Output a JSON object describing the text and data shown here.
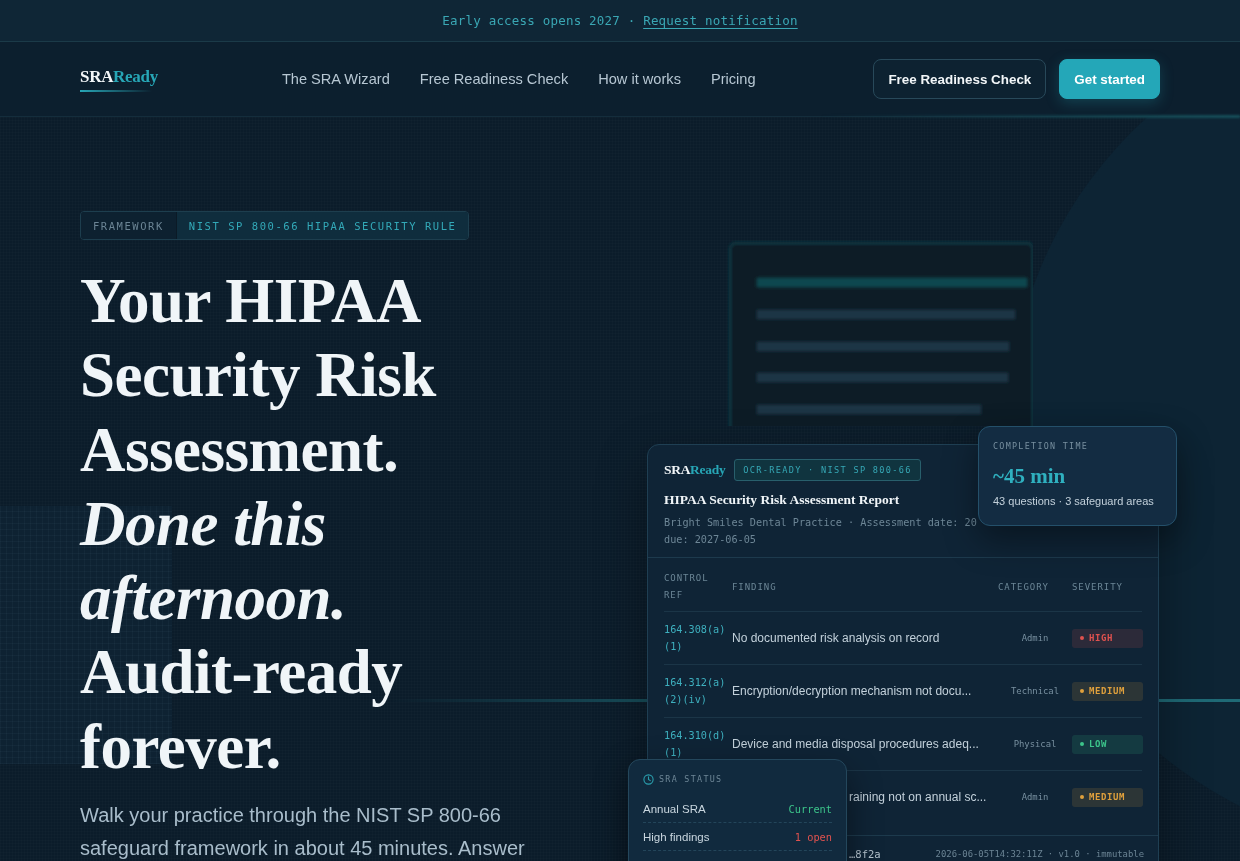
{
  "announcement": {
    "text": "Early access opens 2027 ·",
    "link": "Request notification"
  },
  "nav": {
    "logo": {
      "lead": "SRA",
      "accent": "Ready"
    },
    "links": [
      "The SRA Wizard",
      "Free Readiness Check",
      "How it works",
      "Pricing"
    ],
    "buttons": [
      {
        "label": "Free Readiness Check",
        "kind": "outline"
      },
      {
        "label": "Get started",
        "kind": "primary"
      }
    ]
  },
  "hero": {
    "tag": {
      "label": "FRAMEWORK",
      "value": "NIST SP 800-66 HIPAA SECURITY RULE"
    },
    "heading": "Your HIPAA Security Risk Assessment. *Done this afternoon.* Audit-ready forever.",
    "intro": "Walk your practice through the NIST SP 800-66 safeguard framework in about 45 minutes. Answer"
  },
  "report": {
    "logo": {
      "lead": "SRA",
      "accent": "Ready"
    },
    "badge": "OCR-READY · NIST SP 800-66",
    "title": "HIPAA Security Risk Assessment Report",
    "meta": [
      "Bright Smiles Dental Practice · Assessment date: 20",
      "due: 2027-06-05"
    ],
    "columns": [
      "CONTROL REF",
      "FINDING",
      "CATEGORY",
      "SEVERITY"
    ],
    "rows": [
      {
        "ref": "164.308(a)(1)",
        "finding": "No documented risk analysis on record",
        "category": "Admin",
        "severity": "HIGH",
        "color": "#e0524f"
      },
      {
        "ref": "164.312(a)(2)(iv)",
        "finding": "Encryption/decryption mechanism not docu...",
        "category": "Technical",
        "severity": "MEDIUM",
        "color": "#e0a03c"
      },
      {
        "ref": "164.310(d)(1)",
        "finding": "Device and media disposal procedures adeq...",
        "category": "Physical",
        "severity": "LOW",
        "color": "#3cc48a"
      },
      {
        "finding": "raining not on annual sc...",
        "category": "Admin",
        "severity": "MEDIUM",
        "color": "#e0a03c"
      }
    ],
    "footer": {
      "hash": "…8f2a",
      "stamp": "2026-06-05T14:32:11Z · v1.0 · immutable"
    }
  },
  "completion_card": {
    "label": "COMPLETION TIME",
    "value": "~45 min",
    "detail": "43 questions · 3 safeguard areas"
  },
  "status_card": {
    "title": "SRA STATUS",
    "rows": [
      {
        "label": "Annual SRA",
        "value": "Current",
        "color": "#3cc48a"
      },
      {
        "label": "High findings",
        "value": "1 open",
        "color": "#e0524f"
      }
    ]
  }
}
